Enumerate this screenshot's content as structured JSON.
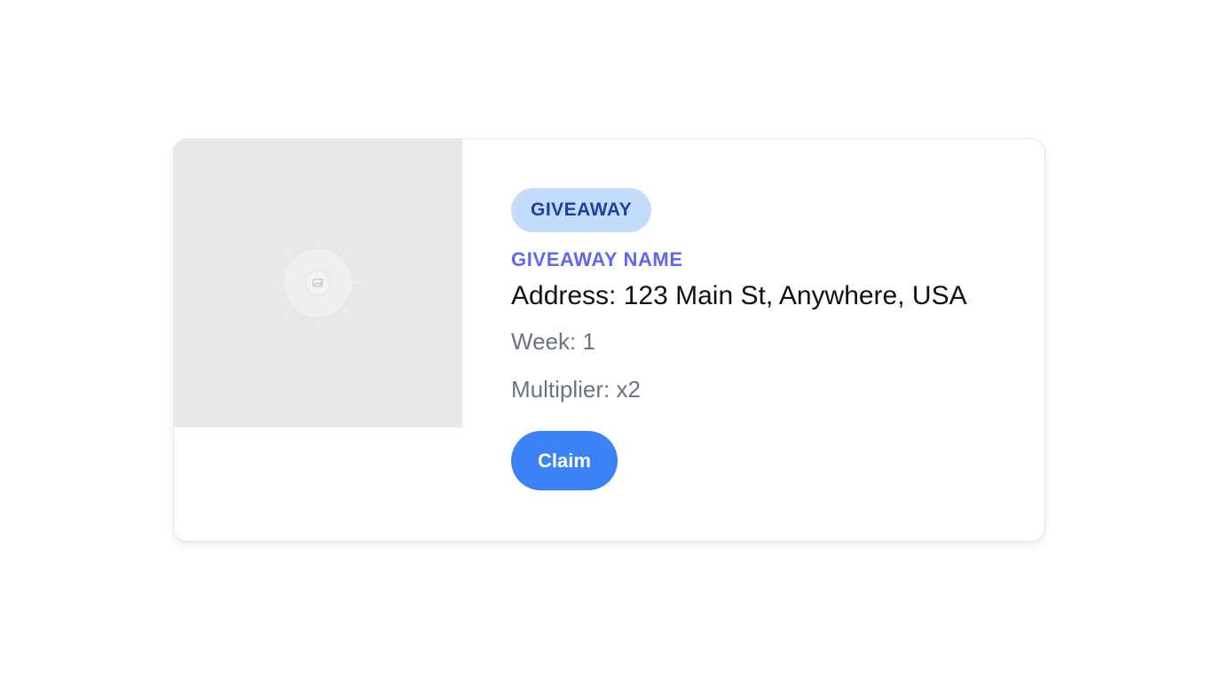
{
  "card": {
    "badge": "GIVEAWAY",
    "name": "GIVEAWAY NAME",
    "address": "Address: 123 Main St, Anywhere, USA",
    "week": "Week: 1",
    "multiplier": "Multiplier: x2",
    "claim_label": "Claim",
    "image_icon": "image-placeholder-icon"
  },
  "colors": {
    "badge_bg": "#c3dcfb",
    "badge_text": "#1e3fa3",
    "name_text": "#6366f1",
    "meta_text": "#6b7280",
    "button_bg": "#3b82f6",
    "placeholder_bg": "#e8e8e8"
  }
}
